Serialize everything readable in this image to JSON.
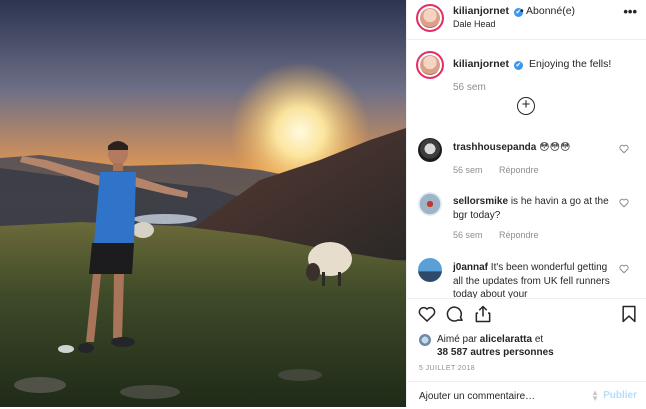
{
  "post": {
    "author": "kilianjornet",
    "follow_text": "• Abonné(e)",
    "location": "Dale Head",
    "more_icon": "ellipsis-icon",
    "caption": "Enjoying the fells!",
    "caption_time": "56 sem",
    "load_more_icon": "plus-circle-icon",
    "verified_mark": "✔"
  },
  "comments": [
    {
      "user": "trashhousepanda",
      "text": "😳😳😳",
      "time": "56 sem",
      "reply": "Répondre"
    },
    {
      "user": "sellorsmike",
      "text": "is he havin a go at the bgr today?",
      "time": "56 sem",
      "reply": "Répondre"
    },
    {
      "user": "j0annaf",
      "text": "It's been wonderful getting all the updates from UK fell runners today about your",
      "time": "",
      "reply": ""
    }
  ],
  "actions": {
    "like_icon": "heart-icon",
    "comment_icon": "comment-icon",
    "share_icon": "share-icon",
    "save_icon": "bookmark-icon"
  },
  "likes": {
    "prefix": "Aimé par",
    "user": "alicelaratta",
    "suffix": "et",
    "count_text": "38 587 autres personnes"
  },
  "date": "5 JUILLET 2018",
  "add_comment": {
    "placeholder": "Ajouter un commentaire…",
    "publish_label": "Publier"
  },
  "colors": {
    "accent": "#3897f0",
    "text": "#262626",
    "muted": "#8e8e8e",
    "story_ring": "#e1306c",
    "publish_disabled": "#b2dffc"
  }
}
